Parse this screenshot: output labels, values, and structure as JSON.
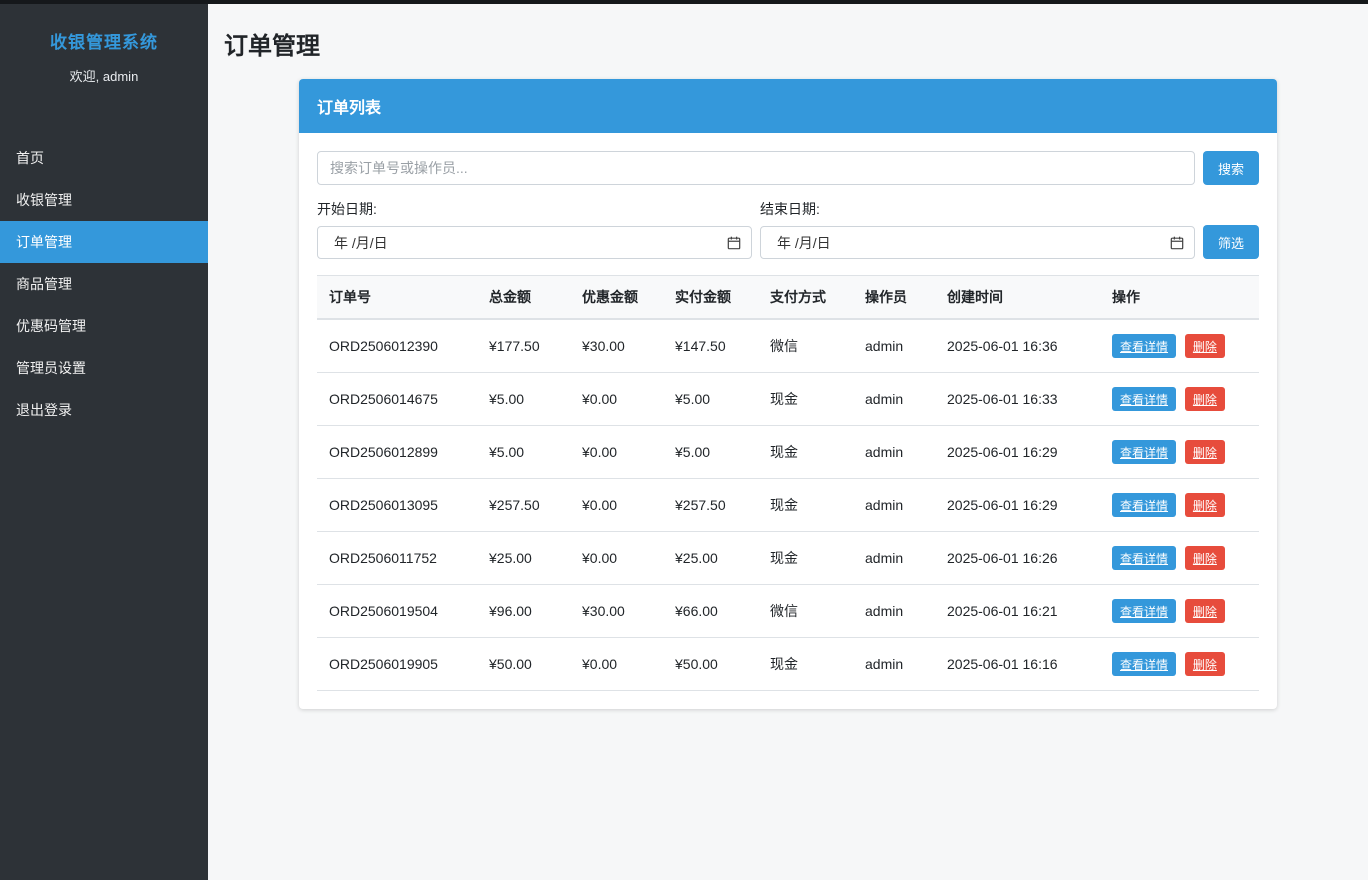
{
  "colors": {
    "accent": "#3498db",
    "danger": "#e74c3c",
    "sidebar_bg": "#2d3237",
    "topbar": "#15181b"
  },
  "sidebar": {
    "title": "收银管理系统",
    "welcome": "欢迎, admin",
    "items": [
      {
        "name": "home",
        "label": "首页",
        "active": false
      },
      {
        "name": "cashier",
        "label": "收银管理",
        "active": false
      },
      {
        "name": "orders",
        "label": "订单管理",
        "active": true
      },
      {
        "name": "products",
        "label": "商品管理",
        "active": false
      },
      {
        "name": "coupons",
        "label": "优惠码管理",
        "active": false
      },
      {
        "name": "admin-settings",
        "label": "管理员设置",
        "active": false
      },
      {
        "name": "logout",
        "label": "退出登录",
        "active": false
      }
    ]
  },
  "page": {
    "title": "订单管理"
  },
  "card": {
    "header": "订单列表"
  },
  "search": {
    "placeholder": "搜索订单号或操作员...",
    "button_label": "搜索"
  },
  "filters": {
    "start_label": "开始日期:",
    "end_label": "结束日期:",
    "date_placeholder": "年 /月/日",
    "filter_button_label": "筛选"
  },
  "table": {
    "headers": [
      "订单号",
      "总金额",
      "优惠金额",
      "实付金额",
      "支付方式",
      "操作员",
      "创建时间",
      "操作"
    ],
    "actions": {
      "view": "查看详情",
      "delete": "删除"
    },
    "rows": [
      {
        "order_no": "ORD2506012390",
        "total": "¥177.50",
        "discount": "¥30.00",
        "paid": "¥147.50",
        "payment": "微信",
        "operator": "admin",
        "created": "2025-06-01 16:36"
      },
      {
        "order_no": "ORD2506014675",
        "total": "¥5.00",
        "discount": "¥0.00",
        "paid": "¥5.00",
        "payment": "现金",
        "operator": "admin",
        "created": "2025-06-01 16:33"
      },
      {
        "order_no": "ORD2506012899",
        "total": "¥5.00",
        "discount": "¥0.00",
        "paid": "¥5.00",
        "payment": "现金",
        "operator": "admin",
        "created": "2025-06-01 16:29"
      },
      {
        "order_no": "ORD2506013095",
        "total": "¥257.50",
        "discount": "¥0.00",
        "paid": "¥257.50",
        "payment": "现金",
        "operator": "admin",
        "created": "2025-06-01 16:29"
      },
      {
        "order_no": "ORD2506011752",
        "total": "¥25.00",
        "discount": "¥0.00",
        "paid": "¥25.00",
        "payment": "现金",
        "operator": "admin",
        "created": "2025-06-01 16:26"
      },
      {
        "order_no": "ORD2506019504",
        "total": "¥96.00",
        "discount": "¥30.00",
        "paid": "¥66.00",
        "payment": "微信",
        "operator": "admin",
        "created": "2025-06-01 16:21"
      },
      {
        "order_no": "ORD2506019905",
        "total": "¥50.00",
        "discount": "¥0.00",
        "paid": "¥50.00",
        "payment": "现金",
        "operator": "admin",
        "created": "2025-06-01 16:16"
      }
    ]
  }
}
